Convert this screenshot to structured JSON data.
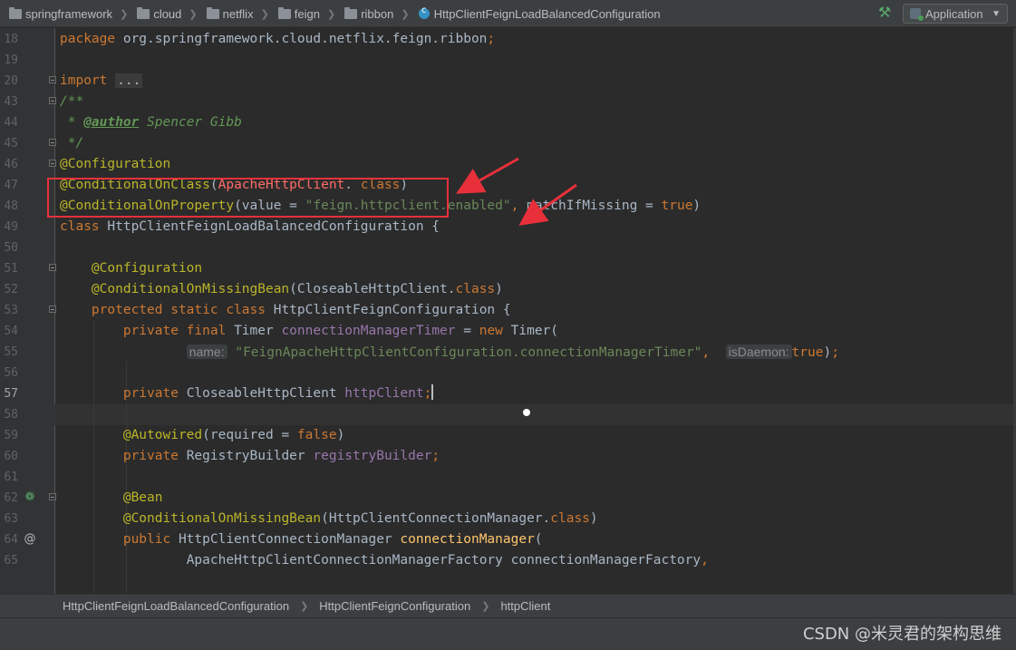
{
  "navbar": {
    "breadcrumbs": [
      "springframework",
      "cloud",
      "netflix",
      "feign",
      "ribbon"
    ],
    "current_class": "HttpClientFeignLoadBalancedConfiguration",
    "run_config": "Application"
  },
  "editor": {
    "current_line": "57",
    "lines": [
      {
        "n": "18",
        "t": [
          [
            "kw",
            "package "
          ],
          [
            "",
            "org.springframework.cloud.netflix.feign.ribbon"
          ],
          [
            "kw",
            ";"
          ]
        ]
      },
      {
        "n": "19",
        "t": []
      },
      {
        "n": "20",
        "t": [
          [
            "kw",
            "import "
          ],
          [
            "dots",
            "..."
          ]
        ]
      },
      {
        "n": "43",
        "t": [
          [
            "cm",
            "/**"
          ]
        ]
      },
      {
        "n": "44",
        "t": [
          [
            "cm",
            " * "
          ],
          [
            "tag",
            "@author"
          ],
          [
            "cm",
            " Spencer Gibb"
          ]
        ]
      },
      {
        "n": "45",
        "t": [
          [
            "cm",
            " */"
          ]
        ]
      },
      {
        "n": "46",
        "t": [
          [
            "an",
            "@Configuration"
          ]
        ]
      },
      {
        "n": "47",
        "t": [
          [
            "an",
            "@ConditionalOnClass"
          ],
          [
            "",
            "("
          ],
          [
            "err",
            "ApacheHttpClient"
          ],
          [
            "",
            ". "
          ],
          [
            "kw",
            "class"
          ],
          [
            "",
            ")"
          ]
        ]
      },
      {
        "n": "48",
        "t": [
          [
            "an",
            "@ConditionalOnProperty"
          ],
          [
            "",
            "(value = "
          ],
          [
            "st",
            "\"feign.httpclient.enabled\""
          ],
          [
            "kw",
            ","
          ],
          [
            "",
            " matchIfMissing = "
          ],
          [
            "kw",
            "true"
          ],
          [
            "",
            ")"
          ]
        ]
      },
      {
        "n": "49",
        "t": [
          [
            "kw",
            "class "
          ],
          [
            "",
            "HttpClientFeignLoadBalancedConfiguration {"
          ]
        ]
      },
      {
        "n": "50",
        "t": []
      },
      {
        "n": "51",
        "t": [
          [
            "",
            "    "
          ],
          [
            "an",
            "@Configuration"
          ]
        ]
      },
      {
        "n": "52",
        "t": [
          [
            "",
            "    "
          ],
          [
            "an",
            "@ConditionalOnMissingBean"
          ],
          [
            "",
            "(CloseableHttpClient."
          ],
          [
            "kw",
            "class"
          ],
          [
            "",
            ")"
          ]
        ]
      },
      {
        "n": "53",
        "t": [
          [
            "",
            "    "
          ],
          [
            "kw",
            "protected static class "
          ],
          [
            "",
            "HttpClientFeignConfiguration {"
          ]
        ]
      },
      {
        "n": "54",
        "t": [
          [
            "",
            "        "
          ],
          [
            "kw",
            "private final "
          ],
          [
            "",
            "Timer "
          ],
          [
            "fd",
            "connectionManagerTimer"
          ],
          [
            "",
            " = "
          ],
          [
            "kw",
            "new "
          ],
          [
            "",
            "Timer("
          ]
        ]
      },
      {
        "n": "55",
        "t": [
          [
            "",
            "                "
          ],
          [
            "hint",
            "name:"
          ],
          [
            "",
            " "
          ],
          [
            "st",
            "\"FeignApacheHttpClientConfiguration.connectionManagerTimer\""
          ],
          [
            "kw",
            ","
          ],
          [
            "",
            "  "
          ],
          [
            "hint",
            "isDaemon:"
          ],
          [
            "kw",
            "true"
          ],
          [
            "",
            ")"
          ],
          [
            "kw",
            ";"
          ]
        ]
      },
      {
        "n": "56",
        "t": []
      },
      {
        "n": "57",
        "t": [
          [
            "",
            "        "
          ],
          [
            "kw",
            "private "
          ],
          [
            "",
            "CloseableHttpClient "
          ],
          [
            "fd",
            "httpClient"
          ],
          [
            "kw",
            ";"
          ],
          [
            "caret",
            ""
          ]
        ]
      },
      {
        "n": "58",
        "t": []
      },
      {
        "n": "59",
        "t": [
          [
            "",
            "        "
          ],
          [
            "an",
            "@Autowired"
          ],
          [
            "",
            "(required = "
          ],
          [
            "kw",
            "false"
          ],
          [
            "",
            ")"
          ]
        ]
      },
      {
        "n": "60",
        "t": [
          [
            "",
            "        "
          ],
          [
            "kw",
            "private "
          ],
          [
            "",
            "RegistryBuilder "
          ],
          [
            "fd",
            "registryBuilder"
          ],
          [
            "kw",
            ";"
          ]
        ]
      },
      {
        "n": "61",
        "t": []
      },
      {
        "n": "62",
        "t": [
          [
            "",
            "        "
          ],
          [
            "an",
            "@Bean"
          ]
        ]
      },
      {
        "n": "63",
        "t": [
          [
            "",
            "        "
          ],
          [
            "an",
            "@ConditionalOnMissingBean"
          ],
          [
            "",
            "(HttpClientConnectionManager."
          ],
          [
            "kw",
            "class"
          ],
          [
            "",
            ")"
          ]
        ]
      },
      {
        "n": "64",
        "t": [
          [
            "",
            "        "
          ],
          [
            "kw",
            "public "
          ],
          [
            "",
            "HttpClientConnectionManager "
          ],
          [
            "fn",
            "connectionManager"
          ],
          [
            "",
            "("
          ]
        ]
      },
      {
        "n": "65",
        "t": [
          [
            "",
            "                "
          ],
          [
            "",
            "ApacheHttpClientConnectionManagerFactory connectionManagerFactory"
          ],
          [
            "kw",
            ","
          ]
        ]
      }
    ]
  },
  "bottom_breadcrumbs": [
    "HttpClientFeignLoadBalancedConfiguration",
    "HttpClientFeignConfiguration",
    "httpClient"
  ],
  "watermark": "CSDN @米灵君的架构思维",
  "icons": {
    "build": "hammer-icon",
    "bean_gutter": "spring-bean-icon",
    "override_gutter": "at-icon"
  },
  "colors": {
    "keyword": "#cc7832",
    "annotation": "#bbb529",
    "string": "#6a8759",
    "field": "#9876aa",
    "error": "#ff6b68",
    "highlight_box": "#e8303a"
  }
}
